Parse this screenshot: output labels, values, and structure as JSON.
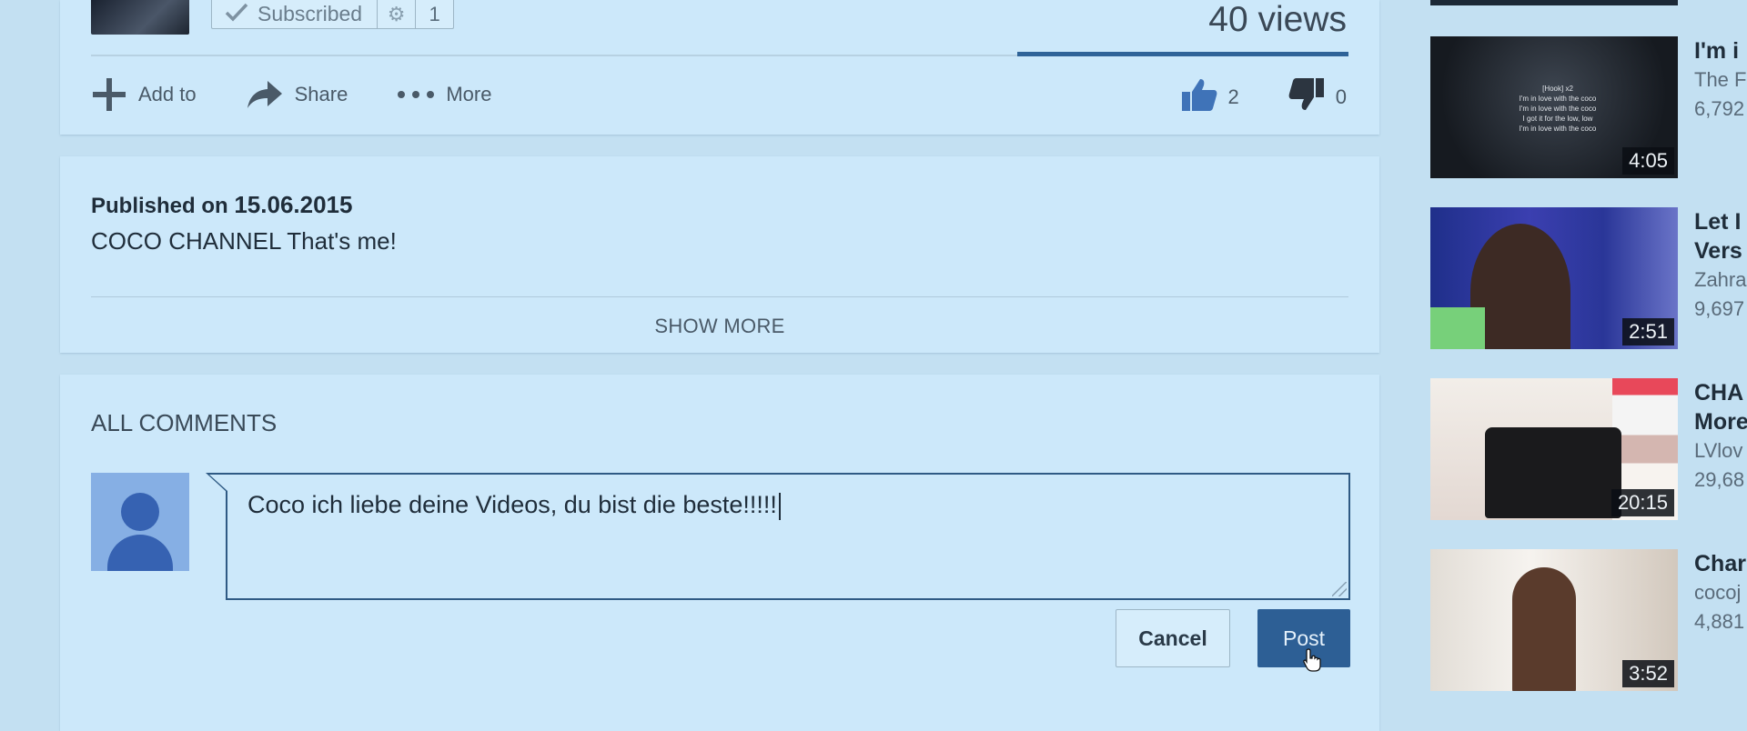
{
  "owner": {
    "subscribe_label": "Subscribed",
    "subscriber_count": "1",
    "views": "40 views"
  },
  "actions": {
    "add_to": "Add to",
    "share": "Share",
    "more": "More",
    "likes": "2",
    "dislikes": "0"
  },
  "description": {
    "published_prefix": "Published on",
    "published_date": "15.06.2015",
    "text": "COCO CHANNEL That's me!",
    "show_more": "SHOW MORE"
  },
  "comments": {
    "title": "ALL COMMENTS",
    "draft": "Coco ich liebe deine Videos, du bist die beste!!!!!",
    "cancel_label": "Cancel",
    "post_label": "Post"
  },
  "sidebar": {
    "items": [
      {
        "title": "I'm i",
        "channel": "The F",
        "views": "6,792",
        "duration": "4:05",
        "lyrics": "[Hook] x2\nI'm in love with the coco\nI'm in love with the coco\nI got it for the low, low\nI'm in love with the coco"
      },
      {
        "title": "Let I",
        "title2": "Vers",
        "channel": "Zahra",
        "views": "9,697",
        "duration": "2:51"
      },
      {
        "title": "CHA",
        "title2": "More",
        "channel": "LVlov",
        "views": "29,68",
        "duration": "20:15"
      },
      {
        "title": "Char",
        "channel": "cocoj",
        "views": "4,881",
        "duration": "3:52"
      }
    ]
  },
  "colors": {
    "background": "#c3e0f2",
    "card": "#cce8fa",
    "accent": "#2d5f95"
  }
}
